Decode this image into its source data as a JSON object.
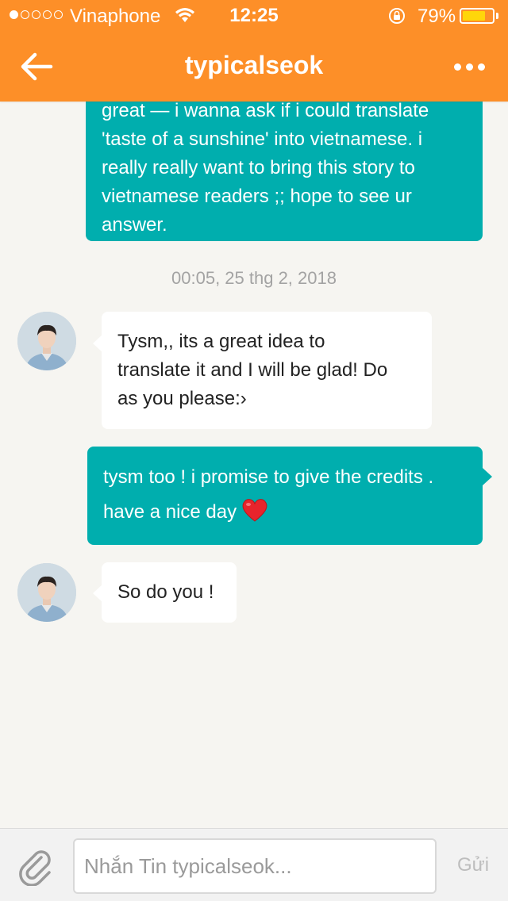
{
  "status_bar": {
    "carrier": "Vinaphone",
    "time": "12:25",
    "battery_percent": "79%",
    "battery_level": 0.79,
    "signal_bars": 1,
    "signal_total": 5
  },
  "header": {
    "title": "typicalseok",
    "back_icon": "arrow-left-icon",
    "more_icon": "more-dots-icon"
  },
  "colors": {
    "header": "#fd8f28",
    "outgoing_bubble": "#00aeae",
    "incoming_bubble": "#ffffff",
    "background": "#f6f5f1"
  },
  "messages": [
    {
      "direction": "out",
      "lines": [
        "great — i wanna ask if i could translate",
        "'taste of a sunshine' into vietnamese. i",
        "really really want to bring this story to",
        "vietnamese readers ;; hope to see ur",
        "answer."
      ]
    },
    {
      "direction": "in",
      "lines": [
        "Tysm,,  its a great idea to",
        "translate it and I will be glad! Do",
        "as you please:›"
      ]
    },
    {
      "direction": "out",
      "lines": [
        "tysm too ! i promise to give the credits .",
        "have a nice day"
      ]
    },
    {
      "direction": "in",
      "lines": [
        "So do you !"
      ]
    }
  ],
  "timestamp": "00:05, 25 thg 2, 2018",
  "input": {
    "placeholder": "Nhắn Tin typicalseok...",
    "value": "",
    "send_label": "Gửi",
    "attach_icon": "paperclip-icon"
  }
}
